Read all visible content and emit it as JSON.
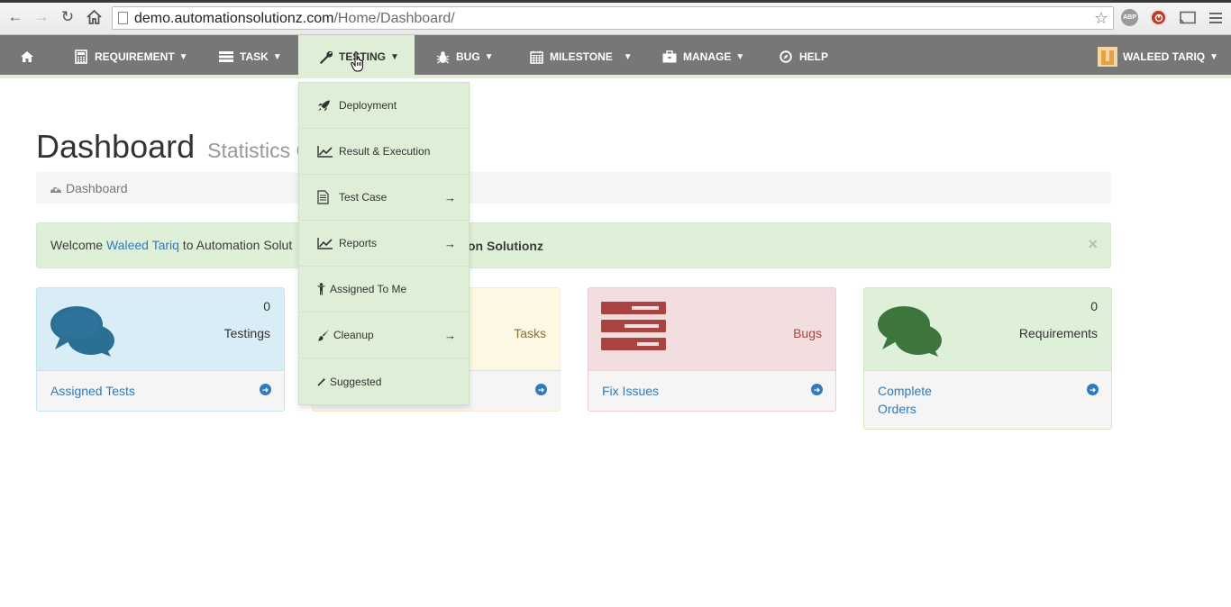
{
  "browser": {
    "url_host": "demo.automationsolutionz.com",
    "url_path": "/Home/Dashboard/",
    "ext_abp": "ABP"
  },
  "navbar": {
    "items": [
      {
        "label": "Requirement",
        "icon": "calculator-icon"
      },
      {
        "label": "Task",
        "icon": "tasks-icon"
      },
      {
        "label": "Testing",
        "icon": "wrench-icon"
      },
      {
        "label": "Bug",
        "icon": "bug-icon"
      },
      {
        "label": "Milestone",
        "icon": "calendar-icon"
      },
      {
        "label": "Manage",
        "icon": "briefcase-icon"
      },
      {
        "label": "Help",
        "icon": "compass-icon"
      }
    ],
    "user": "Waleed Tariq"
  },
  "page": {
    "title": "Dashboard",
    "subtitle": "Statistics C",
    "breadcrumb": "Dashboard"
  },
  "alert": {
    "prefix": "Welcome ",
    "user": "Waleed Tariq",
    "middle": " to Automation Solut",
    "bold_tail": "on Solutionz",
    "close": "×"
  },
  "panels": [
    {
      "count": "0",
      "title": "Testings",
      "link": "Assigned Tests",
      "icon": "comments-icon",
      "color": "#2b6f95"
    },
    {
      "count": "",
      "title": "Tasks",
      "link": "",
      "icon": "tasks-icon",
      "color": "#8a6d3b"
    },
    {
      "count": "",
      "title": "Bugs",
      "link": "Fix Issues",
      "icon": "server-icon",
      "color": "#a94442"
    },
    {
      "count": "0",
      "title": "Requirements",
      "link_line1": "Complete",
      "link_line2": "Orders",
      "icon": "comments-icon",
      "color": "#3c763d"
    }
  ],
  "dropdown": {
    "items": [
      {
        "label": "Deployment",
        "icon": "rocket-icon",
        "submenu": false
      },
      {
        "label": "Result & Execution",
        "icon": "line-chart-icon",
        "submenu": true,
        "submenu_hidden": true
      },
      {
        "label": "Test Case",
        "icon": "document-icon",
        "submenu": true
      },
      {
        "label": "Reports",
        "icon": "line-chart-icon",
        "submenu": true
      },
      {
        "label": "Assigned To Me",
        "icon": "person-icon",
        "submenu": false
      },
      {
        "label": "Cleanup",
        "icon": "brush-icon",
        "submenu": true
      },
      {
        "label": "Suggested",
        "icon": "wand-icon",
        "submenu": false
      }
    ],
    "arrow": "→"
  },
  "colors": {
    "navbar_bg": "#777777",
    "active_bg": "#dfeed7",
    "link": "#337ab7"
  }
}
